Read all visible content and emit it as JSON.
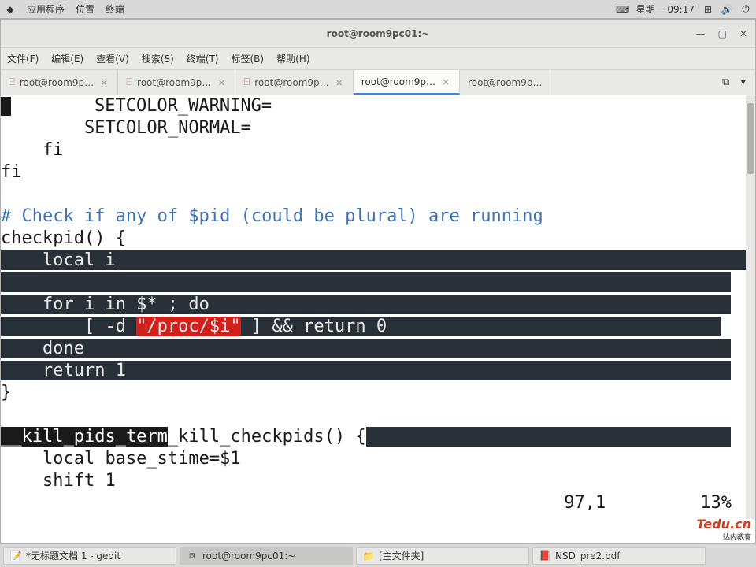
{
  "top_panel": {
    "menu": [
      "应用程序",
      "位置",
      "终端"
    ],
    "clock": "星期一 09:17",
    "icons": [
      "keyboard-icon",
      "network-icon",
      "volume-icon",
      "power-icon"
    ]
  },
  "window": {
    "title": "root@room9pc01:~",
    "controls": {
      "min": "—",
      "max": "▢",
      "close": "✕"
    }
  },
  "menubar": [
    "文件(F)",
    "编辑(E)",
    "查看(V)",
    "搜索(S)",
    "终端(T)",
    "标签(B)",
    "帮助(H)"
  ],
  "tabs": {
    "items": [
      {
        "label": "root@room9p…",
        "active": false
      },
      {
        "label": "root@room9p…",
        "active": false
      },
      {
        "label": "root@room9p…",
        "active": false
      },
      {
        "label": "root@room9p…",
        "active": true
      },
      {
        "label": "root@room9p…",
        "active": false
      }
    ],
    "close_glyph": "×"
  },
  "code": {
    "line1": "        SETCOLOR_WARNING=",
    "line2": "        SETCOLOR_NORMAL=",
    "line3": "    fi",
    "line4": "fi",
    "line5": "",
    "line6": "# Check if any of $pid (could be plural) are running",
    "line7": "checkpid() {",
    "hl1": "    local i",
    "hl2": "",
    "hl3_a": "    for i in $* ; do",
    "hl4_a": "        [ -d ",
    "hl4_red": "\"/proc/$i\"",
    "hl4_b": " ] && return 0",
    "hl5": "    done",
    "hl6": "    return 1",
    "line8": "}",
    "line9": "",
    "line10_rev": "__kill_pids_term",
    "line10_b": "_kill_checkpids() {",
    "line11": "    local base_stime=$1",
    "line12": "    shift 1"
  },
  "vim_status": {
    "pos": "97,1",
    "percent": "13%"
  },
  "taskbar": {
    "items": [
      {
        "icon": "gedit-icon",
        "label": "*无标题文档 1 - gedit",
        "active": false
      },
      {
        "icon": "terminal-icon",
        "label": "root@room9pc01:~",
        "active": true
      },
      {
        "icon": "files-icon",
        "label": "[主文件夹]",
        "active": false
      },
      {
        "icon": "pdf-icon",
        "label": "NSD_pre2.pdf",
        "active": false
      }
    ]
  },
  "logo": {
    "main": "Tedu.cn",
    "sub": "达内教育"
  }
}
